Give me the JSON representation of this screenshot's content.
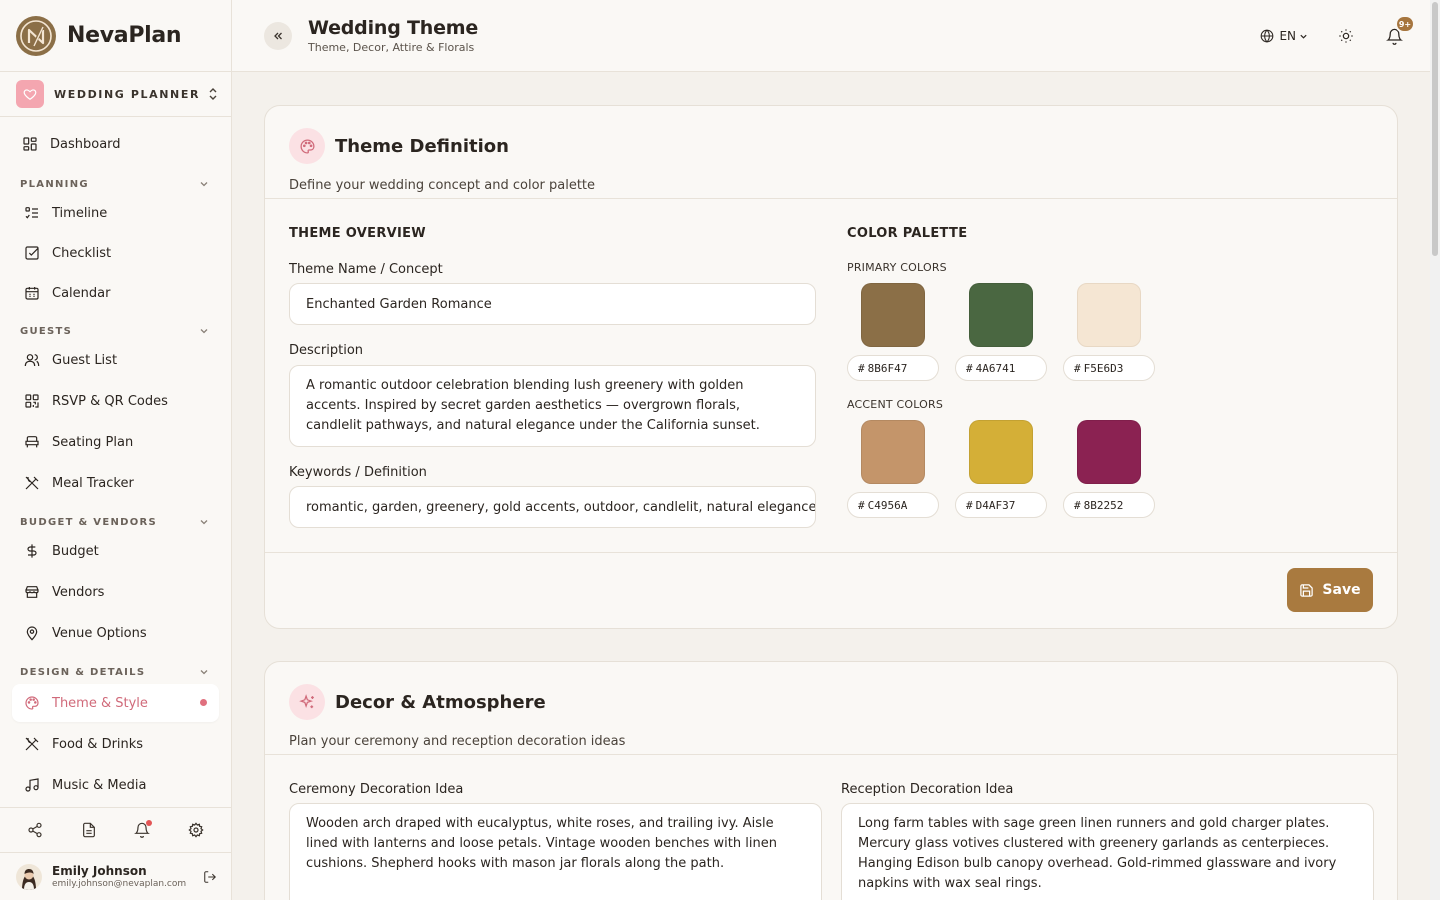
{
  "brand": {
    "name": "NevaPlan"
  },
  "workspace": {
    "label": "WEDDING PLANNER"
  },
  "nav": {
    "dashboard": "Dashboard",
    "sections": [
      {
        "title": "PLANNING",
        "items": [
          "Timeline",
          "Checklist",
          "Calendar"
        ]
      },
      {
        "title": "GUESTS",
        "items": [
          "Guest List",
          "RSVP & QR Codes",
          "Seating Plan",
          "Meal Tracker"
        ]
      },
      {
        "title": "BUDGET & VENDORS",
        "items": [
          "Budget",
          "Vendors",
          "Venue Options"
        ]
      },
      {
        "title": "DESIGN & DETAILS",
        "items": [
          "Theme & Style",
          "Food & Drinks",
          "Music & Media"
        ]
      }
    ]
  },
  "user": {
    "name": "Emily Johnson",
    "email": "emily.johnson@nevaplan.com"
  },
  "header": {
    "title": "Wedding Theme",
    "subtitle": "Theme, Decor, Attire & Florals",
    "lang": "EN",
    "notif_badge": "9+"
  },
  "theme_card": {
    "title": "Theme Definition",
    "subtitle": "Define your wedding concept and color palette",
    "overview_title": "THEME OVERVIEW",
    "name_label": "Theme Name / Concept",
    "name_value": "Enchanted Garden Romance",
    "desc_label": "Description",
    "desc_value": "A romantic outdoor celebration blending lush greenery with golden accents. Inspired by secret garden aesthetics — overgrown florals, candlelit pathways, and natural elegance under the California sunset.",
    "kw_label": "Keywords / Definition",
    "kw_value": "romantic, garden, greenery, gold accents, outdoor, candlelit, natural elegance, rustic charm",
    "palette_title": "COLOR PALETTE",
    "primary_label": "PRIMARY COLORS",
    "accent_label": "ACCENT COLORS",
    "primary": [
      {
        "color": "#8B6F47",
        "hex": "8B6F47"
      },
      {
        "color": "#4A6741",
        "hex": "4A6741"
      },
      {
        "color": "#F5E6D3",
        "hex": "F5E6D3"
      }
    ],
    "accent": [
      {
        "color": "#C4956A",
        "hex": "C4956A"
      },
      {
        "color": "#D4AF37",
        "hex": "D4AF37"
      },
      {
        "color": "#8B2252",
        "hex": "8B2252"
      }
    ],
    "save_label": "Save"
  },
  "decor_card": {
    "title": "Decor & Atmosphere",
    "subtitle": "Plan your ceremony and reception decoration ideas",
    "ceremony_label": "Ceremony Decoration Idea",
    "ceremony_value": "Wooden arch draped with eucalyptus, white roses, and trailing ivy. Aisle lined with lanterns and loose petals. Vintage wooden benches with linen cushions. Shepherd hooks with mason jar florals along the path.",
    "reception_label": "Reception Decoration Idea",
    "reception_value": "Long farm tables with sage green linen runners and gold charger plates. Mercury glass votives clustered with greenery garlands as centerpieces. Hanging Edison bulb canopy overhead. Gold-rimmed glassware and ivory napkins with wax seal rings."
  }
}
